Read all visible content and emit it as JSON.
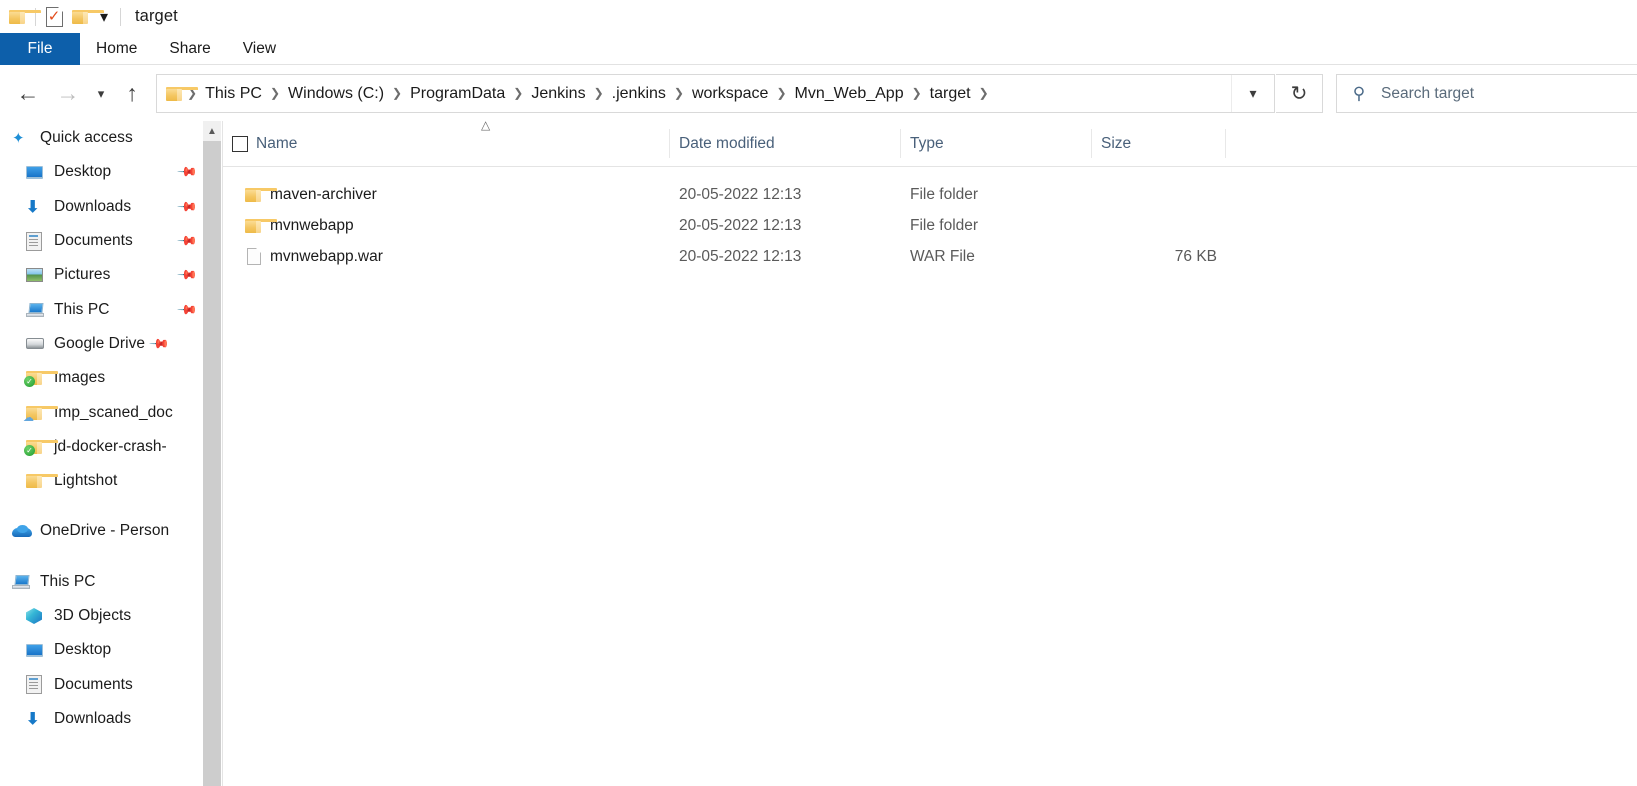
{
  "window": {
    "title": "target",
    "quick_access_toolbar": [
      {
        "name": "folder-icon",
        "label": "Folder"
      },
      {
        "name": "properties-icon",
        "label": "Properties"
      },
      {
        "name": "new-folder-icon",
        "label": "New folder"
      },
      {
        "name": "customize-dropdown-icon",
        "label": "Customize Quick Access Toolbar"
      }
    ]
  },
  "ribbon": {
    "tabs": [
      {
        "label": "File",
        "active": true
      },
      {
        "label": "Home",
        "active": false
      },
      {
        "label": "Share",
        "active": false
      },
      {
        "label": "View",
        "active": false
      }
    ],
    "file_tab_color": "#0d5faa"
  },
  "navigation": {
    "back_label": "Back",
    "forward_label": "Forward",
    "recent_label": "Recent locations",
    "up_label": "Up",
    "breadcrumbs": [
      "This PC",
      "Windows (C:)",
      "ProgramData",
      "Jenkins",
      ".jenkins",
      "workspace",
      "Mvn_Web_App",
      "target"
    ],
    "address_dropdown_label": "Previous locations",
    "refresh_label": "Refresh"
  },
  "search": {
    "placeholder": "Search target"
  },
  "sidebar": {
    "sections": [
      {
        "name": "quick-access",
        "header": {
          "label": "Quick access",
          "icon": "star-icon"
        },
        "items": [
          {
            "label": "Desktop",
            "icon": "monitor-icon",
            "pinned": true
          },
          {
            "label": "Downloads",
            "icon": "download-arrow-icon",
            "pinned": true
          },
          {
            "label": "Documents",
            "icon": "document-icon",
            "pinned": true
          },
          {
            "label": "Pictures",
            "icon": "picture-icon",
            "pinned": true
          },
          {
            "label": "This PC",
            "icon": "computer-icon",
            "pinned": true
          },
          {
            "label": "Google Drive",
            "icon": "drive-icon",
            "pinned": true
          },
          {
            "label": "Images",
            "icon": "folder-synced-icon",
            "pinned": false
          },
          {
            "label": "Imp_scaned_doc",
            "icon": "folder-cloud-icon",
            "pinned": false
          },
          {
            "label": "jd-docker-crash-",
            "icon": "folder-synced-icon",
            "pinned": false
          },
          {
            "label": "Lightshot",
            "icon": "folder-icon",
            "pinned": false
          }
        ]
      },
      {
        "name": "onedrive",
        "header": {
          "label": "OneDrive - Person",
          "icon": "onedrive-icon"
        },
        "items": []
      },
      {
        "name": "this-pc",
        "header": {
          "label": "This PC",
          "icon": "computer-icon"
        },
        "items": [
          {
            "label": "3D Objects",
            "icon": "cube-icon",
            "pinned": false
          },
          {
            "label": "Desktop",
            "icon": "monitor-icon",
            "pinned": false
          },
          {
            "label": "Documents",
            "icon": "document-icon",
            "pinned": false
          },
          {
            "label": "Downloads",
            "icon": "download-arrow-icon",
            "pinned": false
          }
        ]
      }
    ]
  },
  "file_list": {
    "columns": [
      {
        "label": "Name",
        "sorted": "asc"
      },
      {
        "label": "Date modified",
        "sorted": ""
      },
      {
        "label": "Type",
        "sorted": ""
      },
      {
        "label": "Size",
        "sorted": ""
      }
    ],
    "select_all_checked": false,
    "rows": [
      {
        "name": "maven-archiver",
        "date": "20-05-2022 12:13",
        "type": "File folder",
        "size": "",
        "icon": "folder-icon"
      },
      {
        "name": "mvnwebapp",
        "date": "20-05-2022 12:13",
        "type": "File folder",
        "size": "",
        "icon": "folder-icon"
      },
      {
        "name": "mvnwebapp.war",
        "date": "20-05-2022 12:13",
        "type": "WAR File",
        "size": "76 KB",
        "icon": "file-icon"
      }
    ]
  },
  "scrollbar": {
    "up_arrow_label": "Scroll up"
  }
}
